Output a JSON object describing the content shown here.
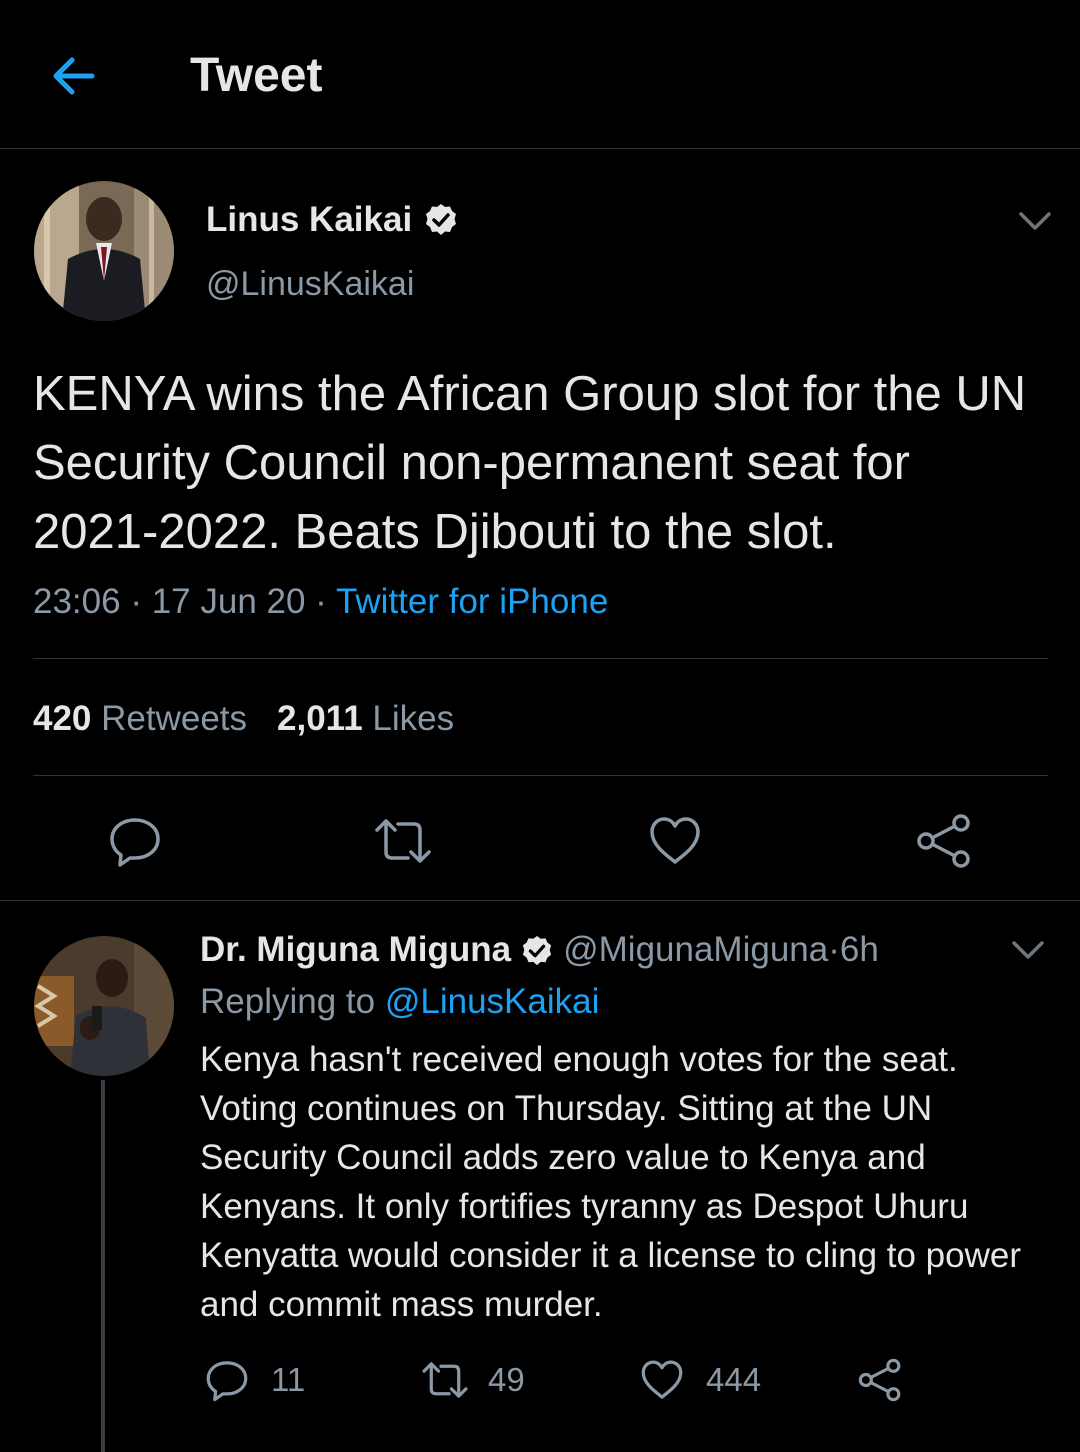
{
  "header": {
    "title": "Tweet",
    "back_icon": "arrow-left-icon"
  },
  "colors": {
    "background": "#000000",
    "accent": "#1da1f2",
    "secondary_text": "#8b98a5",
    "primary_text": "#e6e6e6",
    "divider": "#2f3336"
  },
  "main_tweet": {
    "author_name": "Linus Kaikai",
    "author_handle": "@LinusKaikai",
    "verified": true,
    "text": "KENYA wins the African Group slot for the UN Security Council non-permanent seat for 2021-2022. Beats Djibouti to the slot.",
    "time": "23:06",
    "sep1": " · ",
    "date": "17 Jun 20",
    "sep2": " · ",
    "source": "Twitter for iPhone",
    "retweets_count": "420",
    "retweets_label": " Retweets",
    "likes_count": "2,011",
    "likes_label": " Likes",
    "actions": [
      "reply-icon",
      "retweet-icon",
      "like-icon",
      "share-icon"
    ]
  },
  "reply": {
    "author_name": "Dr. Miguna Miguna",
    "author_handle": "@MigunaMiguna",
    "dot": " · ",
    "time": "6h",
    "verified": true,
    "replying_prefix": "Replying to ",
    "replying_to": "@LinusKaikai",
    "text": "Kenya hasn't received enough votes for the seat. Voting continues on Thursday. Sitting at the UN Security Council adds zero value to Kenya and Kenyans. It only fortifies tyranny as Despot Uhuru Kenyatta would consider it a license to cling to power and commit mass murder.",
    "reply_count": "11",
    "retweet_count": "49",
    "like_count": "444"
  }
}
